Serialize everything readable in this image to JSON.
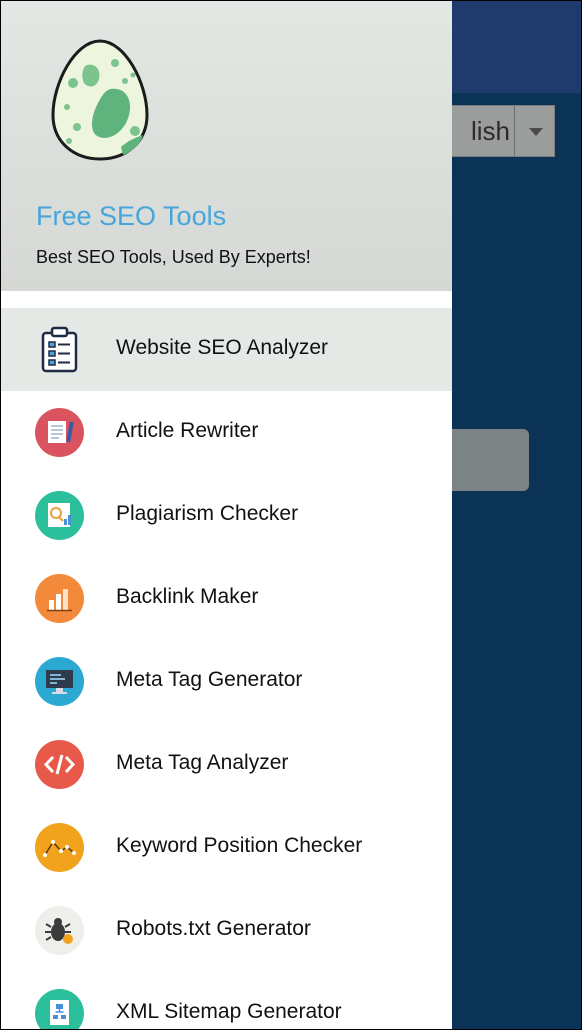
{
  "background": {
    "language_select_text": "lish"
  },
  "drawer": {
    "title": "Free SEO Tools",
    "subtitle": "Best SEO Tools, Used By Experts!",
    "items": [
      {
        "label": "Website SEO Analyzer",
        "icon": "clipboard-checklist-icon",
        "color": "#ffffff",
        "active": true
      },
      {
        "label": "Article Rewriter",
        "icon": "article-rewriter-icon",
        "color": "#d9545e"
      },
      {
        "label": "Plagiarism Checker",
        "icon": "plagiarism-checker-icon",
        "color": "#2cbf9c"
      },
      {
        "label": "Backlink Maker",
        "icon": "backlink-maker-icon",
        "color": "#f3893b"
      },
      {
        "label": "Meta Tag Generator",
        "icon": "monitor-code-icon",
        "color": "#2ba9d3"
      },
      {
        "label": "Meta Tag Analyzer",
        "icon": "code-brackets-icon",
        "color": "#e75a4a"
      },
      {
        "label": "Keyword Position Checker",
        "icon": "chart-line-icon",
        "color": "#f2a31d"
      },
      {
        "label": "Robots.txt Generator",
        "icon": "bug-icon",
        "color": "#eeeeea"
      },
      {
        "label": "XML Sitemap Generator",
        "icon": "sitemap-icon",
        "color": "#2cbf9c"
      }
    ]
  }
}
